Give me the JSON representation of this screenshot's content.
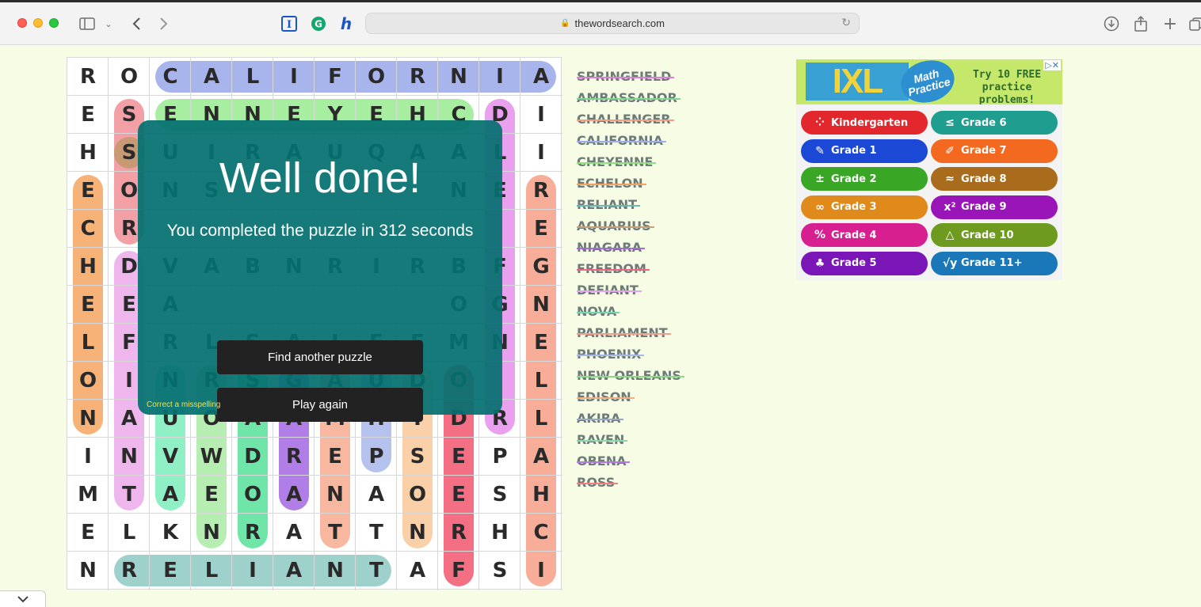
{
  "browser": {
    "url": "thewordsearch.com"
  },
  "grid": [
    [
      "R",
      "O",
      "C",
      "A",
      "L",
      "I",
      "F",
      "O",
      "R",
      "N",
      "I",
      "A"
    ],
    [
      "E",
      "S",
      "E",
      "N",
      "N",
      "E",
      "Y",
      "E",
      "H",
      "C",
      "D",
      "I"
    ],
    [
      "H",
      "S",
      "U",
      "I",
      "R",
      "A",
      "U",
      "Q",
      "A",
      "A",
      "L",
      "I"
    ],
    [
      "E",
      "O",
      "N",
      "S",
      "",
      "",
      "",
      "",
      "",
      "N",
      "E",
      "R"
    ],
    [
      "C",
      "R",
      "",
      "",
      "",
      "",
      "",
      "",
      "",
      "",
      "",
      "E"
    ],
    [
      "H",
      "D",
      "V",
      "A",
      "B",
      "N",
      "R",
      "I",
      "R",
      "B",
      "F",
      "G"
    ],
    [
      "E",
      "E",
      "A",
      "",
      "",
      "",
      "",
      "",
      "",
      "O",
      "G",
      "N"
    ],
    [
      "L",
      "F",
      "R",
      "L",
      "S",
      "A",
      "I",
      "E",
      "E",
      "M",
      "N",
      "E"
    ],
    [
      "O",
      "I",
      "N",
      "R",
      "S",
      "G",
      "A",
      "U",
      "D",
      "O",
      "",
      "L"
    ],
    [
      "N",
      "A",
      "U",
      "O",
      "A",
      "A",
      "M",
      "H",
      "I",
      "D",
      "R",
      "L"
    ],
    [
      "I",
      "N",
      "V",
      "W",
      "D",
      "R",
      "E",
      "P",
      "S",
      "E",
      "P",
      "A"
    ],
    [
      "M",
      "T",
      "A",
      "E",
      "O",
      "A",
      "N",
      "A",
      "O",
      "E",
      "S",
      "H"
    ],
    [
      "E",
      "L",
      "K",
      "N",
      "R",
      "A",
      "T",
      "T",
      "N",
      "R",
      "H",
      "C"
    ],
    [
      "N",
      "R",
      "E",
      "L",
      "I",
      "A",
      "N",
      "T",
      "A",
      "F",
      "S",
      "I"
    ]
  ],
  "words": [
    {
      "text": "SPRINGFIELD",
      "color": "#e07fd6"
    },
    {
      "text": "AMBASSADOR",
      "color": "#7fd68e"
    },
    {
      "text": "CHALLENGER",
      "color": "#f59e80"
    },
    {
      "text": "CALIFORNIA",
      "color": "#9faee8"
    },
    {
      "text": "CHEYENNE",
      "color": "#8de07a"
    },
    {
      "text": "ECHELON",
      "color": "#f5a25e"
    },
    {
      "text": "RELIANT",
      "color": "#6fb7b0"
    },
    {
      "text": "AQUARIUS",
      "color": "#c7a07c"
    },
    {
      "text": "NIAGARA",
      "color": "#a66bdb"
    },
    {
      "text": "FREEDOM",
      "color": "#f06680"
    },
    {
      "text": "DEFIANT",
      "color": "#e6a4f0"
    },
    {
      "text": "NOVA",
      "color": "#6ed6b0"
    },
    {
      "text": "PARLIAMENT",
      "color": "#f5a08a"
    },
    {
      "text": "PHOENIX",
      "color": "#a8b6e8"
    },
    {
      "text": "NEW ORLEANS",
      "color": "#8ed88a"
    },
    {
      "text": "EDISON",
      "color": "#f0b080"
    },
    {
      "text": "AKIRA",
      "color": "#9aa8c8"
    },
    {
      "text": "RAVEN",
      "color": "#8ad8a8"
    },
    {
      "text": "OBENA",
      "color": "#b47ae0"
    },
    {
      "text": "ROSS",
      "color": "#f08080"
    }
  ],
  "modal": {
    "title": "Well done!",
    "message": "You completed the puzzle in 312 seconds",
    "find_another_label": "Find another puzzle",
    "play_again_label": "Play again",
    "correct_link": "Correct a misspelling"
  },
  "ad": {
    "logo": "IXL",
    "badge": "Math Practice",
    "cta": "Try 10 FREE practice problems!",
    "grades": [
      {
        "label": "Kindergarten",
        "icon": "dots-icon",
        "glyph": "⁘",
        "color": "#e2272d"
      },
      {
        "label": "Grade 6",
        "icon": "less-equal-icon",
        "glyph": "≤",
        "color": "#1f9e8f"
      },
      {
        "label": "Grade 1",
        "icon": "pencil-cup-icon",
        "glyph": "✎",
        "color": "#1b49d6"
      },
      {
        "label": "Grade 7",
        "icon": "pencil-icon",
        "glyph": "✐",
        "color": "#f3691f"
      },
      {
        "label": "Grade 2",
        "icon": "plus-minus-icon",
        "glyph": "±",
        "color": "#3aa626"
      },
      {
        "label": "Grade 8",
        "icon": "approx-icon",
        "glyph": "≈",
        "color": "#a86c1c"
      },
      {
        "label": "Grade 3",
        "icon": "infinity-icon",
        "glyph": "∞",
        "color": "#e08a1c"
      },
      {
        "label": "Grade 9",
        "icon": "x-squared-icon",
        "glyph": "x²",
        "color": "#9a15b8"
      },
      {
        "label": "Grade 4",
        "icon": "percent-icon",
        "glyph": "%",
        "color": "#d81f8f"
      },
      {
        "label": "Grade 10",
        "icon": "triangle-icon",
        "glyph": "△",
        "color": "#6e9a20"
      },
      {
        "label": "Grade 5",
        "icon": "apple-books-icon",
        "glyph": "♣",
        "color": "#7a16b8"
      },
      {
        "label": "Grade 11+",
        "icon": "sqrt-icon",
        "glyph": "√y",
        "color": "#1a78b8"
      }
    ],
    "marks": "▷✕"
  }
}
